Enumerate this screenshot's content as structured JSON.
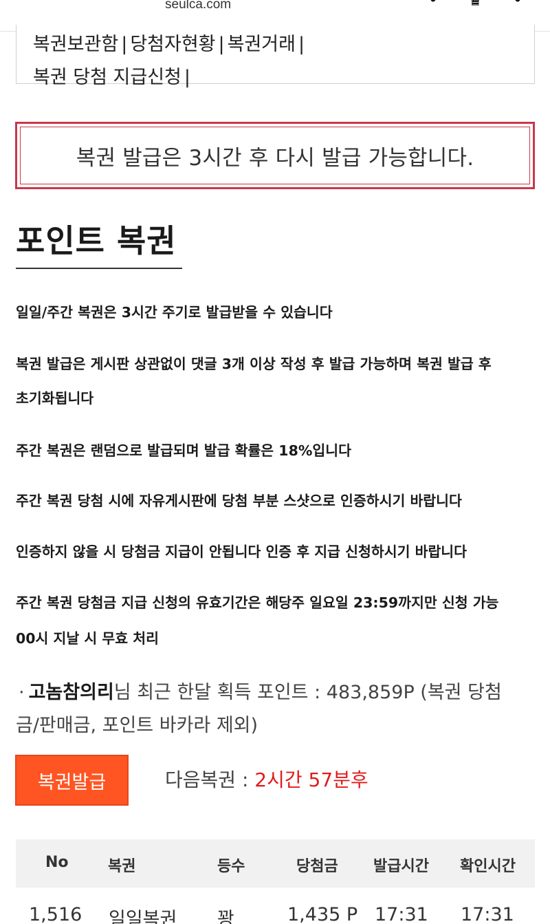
{
  "header": {
    "domain": "seulca.com",
    "icons": [
      "user-icon",
      "crown-icon",
      "menu-icon"
    ]
  },
  "menu": {
    "row1": [
      "복권보관함",
      "당첨자현황",
      "복권거래"
    ],
    "row2": [
      "복권 당첨 지급신청"
    ],
    "separator": "|"
  },
  "notice": {
    "text": "복권 발급은 3시간 후 다시 발급 가능합니다."
  },
  "section": {
    "title": "포인트 복권"
  },
  "rules": [
    "일일/주간 복권은 3시간 주기로 발급받을 수 있습니다",
    "복권 발급은 게시판 상관없이 댓글 3개 이상 작성 후 발급 가능하며 복권 발급 후",
    "초기화됩니다",
    "주간 복권은 랜덤으로 발급되며 발급 확률은 18%입니다",
    "주간 복권 당첨 시에 자유게시판에 당첨 부분 스샷으로 인증하시기 바랍니다",
    "인증하지 않을 시 당첨금 지급이 안됩니다 인증 후 지급 신청하시기 바랍니다",
    "주간 복권 당첨금 지급 신청의 유효기간은 해당주 일요일 23:59까지만 신청 가능",
    "00시 지날 시 무효 처리"
  ],
  "points": {
    "bullet": "·",
    "username": "고놈참의리",
    "line1_rest": "님 최근 한달 획득 포인트 : 483,859P (복권 당첨",
    "line2": "금/판매금, 포인트 바카라 제외)"
  },
  "actions": {
    "issue_button": "복권발급",
    "next_label": "다음복권 : ",
    "next_value": "2시간 57분후"
  },
  "table": {
    "headers": [
      "No",
      "복권",
      "등수",
      "당첨금",
      "발급시간",
      "확인시간"
    ],
    "rows": [
      [
        "1,516",
        "일일복권",
        "꽝",
        "1,435 P",
        "17:31",
        "17:31"
      ]
    ]
  },
  "colors": {
    "notice_border": "#c8384b",
    "issue_button": "#ff5522",
    "next_value": "#e11b1b",
    "table_header_bg": "#f1f1f1"
  }
}
